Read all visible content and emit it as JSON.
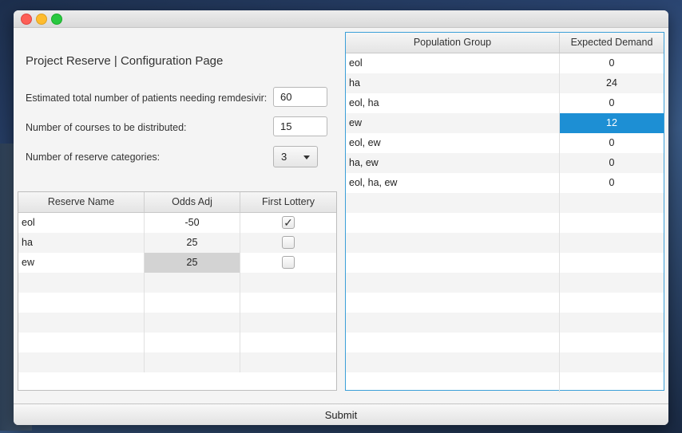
{
  "window": {
    "title": ""
  },
  "page": {
    "title": "Project Reserve | Configuration Page"
  },
  "form": {
    "patients_label": "Estimated total number of patients needing remdesivir:",
    "patients_value": "60",
    "courses_label": "Number of courses to be distributed:",
    "courses_value": "15",
    "categories_label": "Number of reserve categories:",
    "categories_value": "3"
  },
  "reserve_table": {
    "headers": [
      "Reserve Name",
      "Odds Adj",
      "First Lottery"
    ],
    "rows": [
      {
        "name": "eol",
        "odds": "-50",
        "first_lottery": true
      },
      {
        "name": "ha",
        "odds": "25",
        "first_lottery": false
      },
      {
        "name": "ew",
        "odds": "25",
        "first_lottery": false
      }
    ]
  },
  "population_table": {
    "headers": [
      "Population Group",
      "Expected Demand"
    ],
    "rows": [
      {
        "group": "eol",
        "demand": "0"
      },
      {
        "group": "ha",
        "demand": "24"
      },
      {
        "group": "eol, ha",
        "demand": "0"
      },
      {
        "group": "ew",
        "demand": "12"
      },
      {
        "group": "eol, ew",
        "demand": "0"
      },
      {
        "group": "ha, ew",
        "demand": "0"
      },
      {
        "group": "eol, ha, ew",
        "demand": "0"
      }
    ]
  },
  "submit_label": "Submit",
  "colors": {
    "selection": "#1d8fd4",
    "focus_border": "#3b9fd8"
  },
  "icons": {
    "checkmark": "check-icon",
    "dropdown": "chevron-down-icon"
  }
}
